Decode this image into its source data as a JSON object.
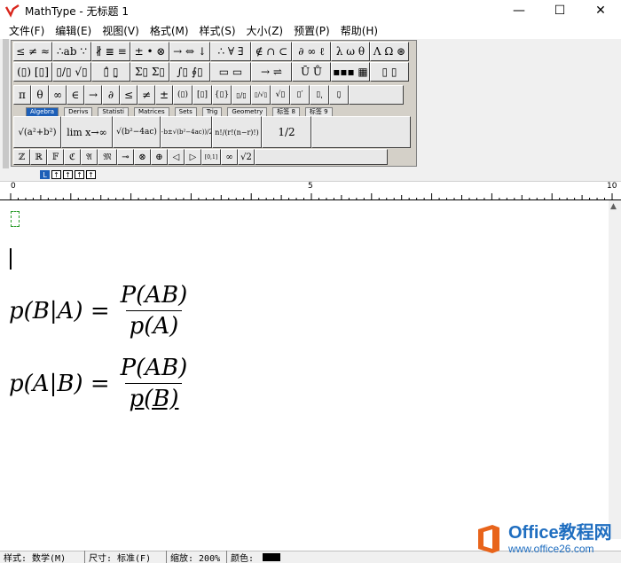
{
  "window": {
    "title": "MathType - 无标题 1",
    "controls": {
      "minimize": "—",
      "maximize": "☐",
      "close": "✕"
    }
  },
  "menu": [
    "文件(F)",
    "编辑(E)",
    "视图(V)",
    "格式(M)",
    "样式(S)",
    "大小(Z)",
    "预置(P)",
    "帮助(H)"
  ],
  "palette": {
    "row1": [
      "≤ ≠ ≈",
      "∴ab ∵",
      "∦ ≣ ≡",
      "± • ⊗",
      "→ ⇔ ↓",
      "∴ ∀ ∃",
      "∉ ∩ ⊂",
      "∂ ∞ ℓ",
      "λ ω θ",
      "Λ Ω ⊛"
    ],
    "row2": [
      "(▯) [▯]",
      "▯/▯ √▯",
      "▯̂ ▯̰",
      "Σ▯ Σ▯",
      "∫▯ ∮▯",
      "▭ ▭",
      "→ ⇌",
      "Ū Ů",
      "▪▪▪ ▦",
      "▯ ▯"
    ],
    "row3": [
      "π",
      "θ",
      "∞",
      "∈",
      "→",
      "∂",
      "≤",
      "≠",
      "±",
      "(▯)",
      "[▯]",
      "{▯}",
      "▯/▯",
      "▯/√▯",
      "√▯",
      "▯′",
      "▯͵",
      "▯̣"
    ],
    "tabs": [
      "Algebra",
      "Derivs",
      "Statisti",
      "Matrices",
      "Sets",
      "Trig",
      "Geometry",
      "标签 8",
      "标签 9"
    ],
    "active_tab": "Algebra",
    "templates": [
      "√(a²+b²)",
      "lim x→∞",
      "√(b²−4ac)",
      "(−b±√(b²−4ac))/2a",
      "n!/(r!(n−r)!)",
      "1/2"
    ],
    "row5": [
      "ℤ",
      "ℝ",
      "𝔽",
      "ℭ",
      "𝔄",
      "𝔐",
      "⊸",
      "⊗",
      "⊕",
      "◁",
      "▷",
      "[0,1]",
      "∞",
      "√2"
    ]
  },
  "tabstops": [
    "L",
    "↑",
    "↑",
    "↑",
    "↑"
  ],
  "ruler": {
    "marks": [
      "0",
      "5",
      "10"
    ]
  },
  "equations": {
    "eq1": {
      "lhs": "p(B|A) =",
      "num": "P(AB)",
      "den": "p(A)"
    },
    "eq2": {
      "lhs": "p(A|B) =",
      "num": "P(AB)",
      "den": "p(B)"
    }
  },
  "status": {
    "style": "样式: 数学(M)",
    "size": "尺寸: 标准(F)",
    "zoom": "缩放: 200%",
    "color": "颜色:"
  },
  "watermark": {
    "main": "Office教程网",
    "sub": "www.office26.com"
  },
  "colors": {
    "tab_active": "#1d5fb8",
    "placeholder": "#2a9b2a",
    "brand": "#1f6ec0",
    "logo_orange": "#e8641b"
  }
}
